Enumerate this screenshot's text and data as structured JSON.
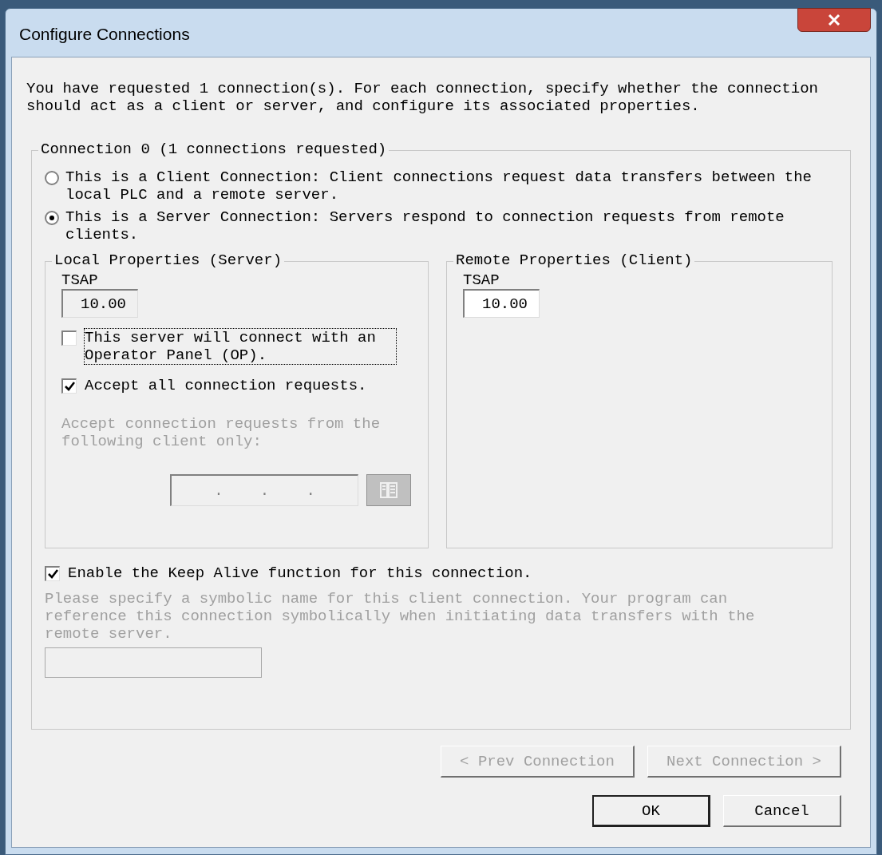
{
  "window": {
    "title": "Configure Connections"
  },
  "intro": "You have requested 1 connection(s).  For each connection, specify whether the connection should act as a client or server, and configure its associated properties.",
  "connection_group": {
    "legend": "Connection 0 (1 connections requested)",
    "roles": [
      {
        "label": "This is a Client Connection: Client connections request data transfers between the local PLC and a remote server.",
        "selected": false
      },
      {
        "label": "This is a Server Connection: Servers respond to connection requests from remote clients.",
        "selected": true
      }
    ],
    "local": {
      "legend": "Local Properties (Server)",
      "tsap_label": "TSAP",
      "tsap_value": "10.00",
      "tsap_readonly": true,
      "options": [
        {
          "label": "This server will connect with an Operator Panel (OP).",
          "checked": false,
          "focused": true
        },
        {
          "label": "Accept all connection requests.",
          "checked": true,
          "focused": false
        }
      ],
      "client_only_label": "Accept connection requests from the following client only:",
      "client_only_disabled": true,
      "ip_separators": [
        ".",
        ".",
        "."
      ]
    },
    "remote": {
      "legend": "Remote Properties (Client)",
      "tsap_label": "TSAP",
      "tsap_value": "10.00",
      "tsap_readonly": false
    },
    "keep_alive": {
      "label": "Enable the Keep Alive function for this connection.",
      "checked": true
    },
    "symbolic_label": "Please specify a symbolic name for this client connection.  Your program can reference this connection symbolically when initiating data transfers with the remote server.",
    "symbolic_disabled": true
  },
  "nav_buttons": [
    {
      "label": "< Prev Connection",
      "disabled": true
    },
    {
      "label": "Next Connection >",
      "disabled": true
    }
  ],
  "buttons": [
    {
      "label": "OK",
      "default": true
    },
    {
      "label": "Cancel",
      "default": false
    }
  ]
}
